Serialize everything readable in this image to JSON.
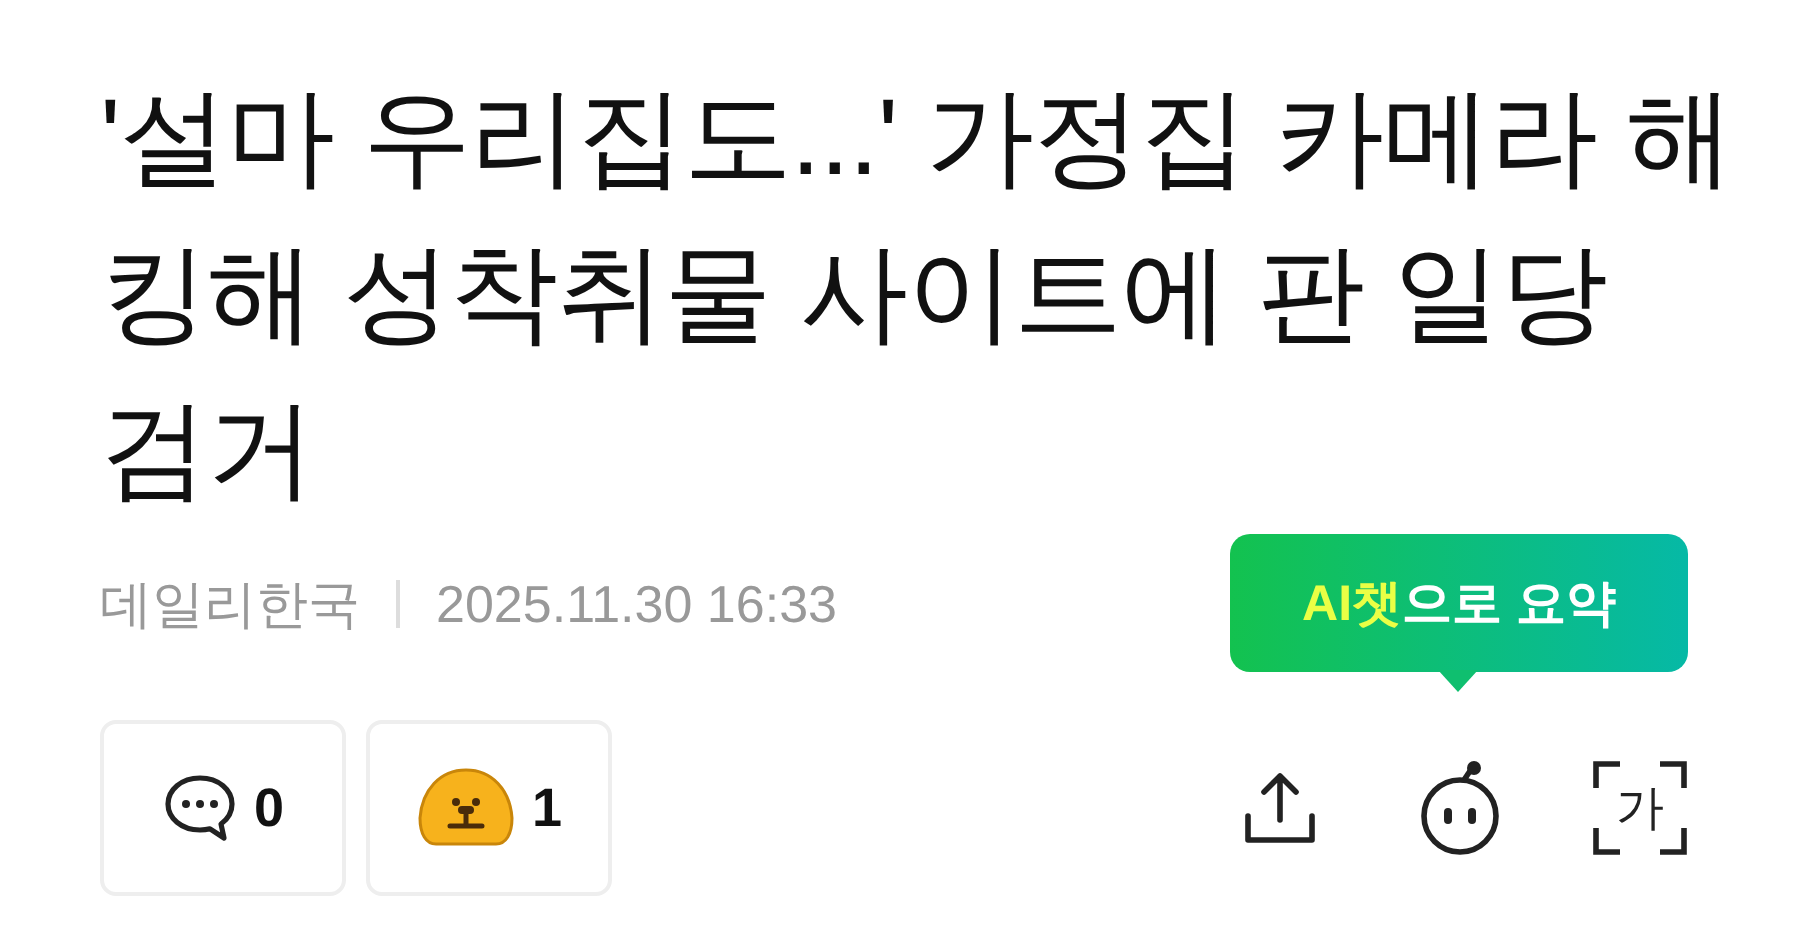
{
  "article": {
    "title": "'설마 우리집도...' 가정집 카메라 해킹해 성착취물 사이트에 판 일당 검거",
    "source": "데일리한국",
    "datetime": "2025.11.30 16:33"
  },
  "ai_summary": {
    "highlight": "AI챗",
    "rest": "으로 요약"
  },
  "reactions": [
    {
      "kind": "comment",
      "count": "0"
    },
    {
      "kind": "emoji",
      "count": "1"
    }
  ],
  "tools": {
    "translate_glyph": "가"
  }
}
